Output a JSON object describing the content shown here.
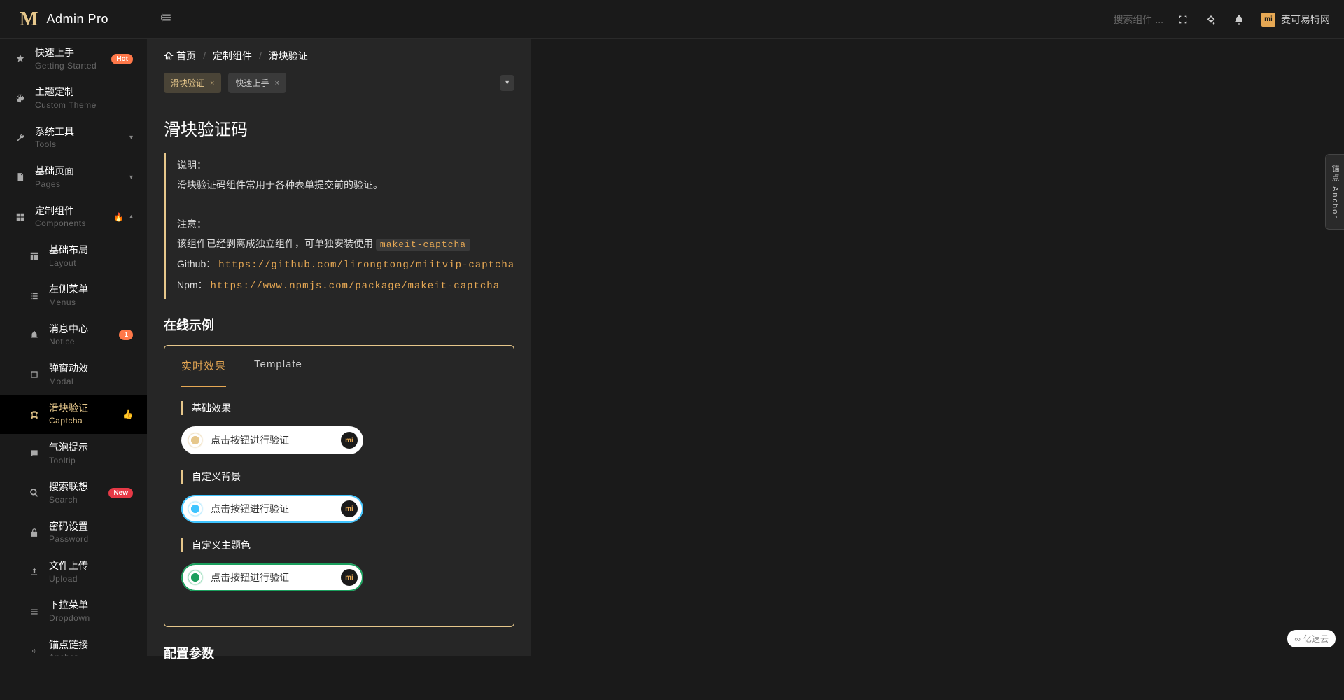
{
  "brand": "Admin Pro",
  "search_placeholder": "搜索组件 ...",
  "user_name": "麦可易特网",
  "avatar_text": "mi",
  "sidebar": [
    {
      "title": "快速上手",
      "sub": "Getting Started",
      "icon": "rocket",
      "badge": "Hot",
      "badge_type": "orange"
    },
    {
      "title": "主题定制",
      "sub": "Custom Theme",
      "icon": "theme"
    },
    {
      "title": "系统工具",
      "sub": "Tools",
      "icon": "tools",
      "arrow": true
    },
    {
      "title": "基础页面",
      "sub": "Pages",
      "icon": "pages",
      "arrow": true
    },
    {
      "title": "定制组件",
      "sub": "Components",
      "icon": "comp",
      "fire": true,
      "arrow_up": true
    }
  ],
  "sidebar_sub": [
    {
      "title": "基础布局",
      "sub": "Layout",
      "icon": "layout"
    },
    {
      "title": "左侧菜单",
      "sub": "Menus",
      "icon": "menu"
    },
    {
      "title": "消息中心",
      "sub": "Notice",
      "icon": "bell",
      "badge": "1",
      "badge_type": "orange"
    },
    {
      "title": "弹窗动效",
      "sub": "Modal",
      "icon": "modal"
    },
    {
      "title": "滑块验证",
      "sub": "Captcha",
      "icon": "captcha",
      "active": true,
      "thumb": true
    },
    {
      "title": "气泡提示",
      "sub": "Tooltip",
      "icon": "tooltip"
    },
    {
      "title": "搜索联想",
      "sub": "Search",
      "icon": "search",
      "badge": "New",
      "badge_type": "red"
    },
    {
      "title": "密码设置",
      "sub": "Password",
      "icon": "password"
    },
    {
      "title": "文件上传",
      "sub": "Upload",
      "icon": "upload"
    },
    {
      "title": "下拉菜单",
      "sub": "Dropdown",
      "icon": "dropdown"
    },
    {
      "title": "锚点链接",
      "sub": "Anchor",
      "icon": "anchor"
    }
  ],
  "breadcrumb": {
    "home": "首页",
    "mid": "定制组件",
    "cur": "滑块验证"
  },
  "tabs": {
    "t1": "滑块验证",
    "t2": "快速上手"
  },
  "page": {
    "title": "滑块验证码",
    "note_title": "说明：",
    "note_desc": "滑块验证码组件常用于各种表单提交前的验证。",
    "warn_title": "注意：",
    "warn_line1_a": "该组件已经剥离成独立组件，可单独安装使用",
    "warn_code": "makeit-captcha",
    "warn_github_label": "Github：",
    "warn_github_url": "https://github.com/lirongtong/miitvip-captcha",
    "warn_npm_label": "Npm：",
    "warn_npm_url": "https://www.npmjs.com/package/makeit-captcha",
    "section_demo": "在线示例",
    "section_config": "配置参数"
  },
  "demo": {
    "tab_live": "实时效果",
    "tab_tpl": "Template",
    "label_basic": "基础效果",
    "label_bg": "自定义背景",
    "label_theme": "自定义主题色",
    "btn_text": "点击按钮进行验证"
  },
  "anchor": "锚点 Anchor",
  "watermark": "亿速云",
  "misc": {
    "close_x": "×"
  }
}
